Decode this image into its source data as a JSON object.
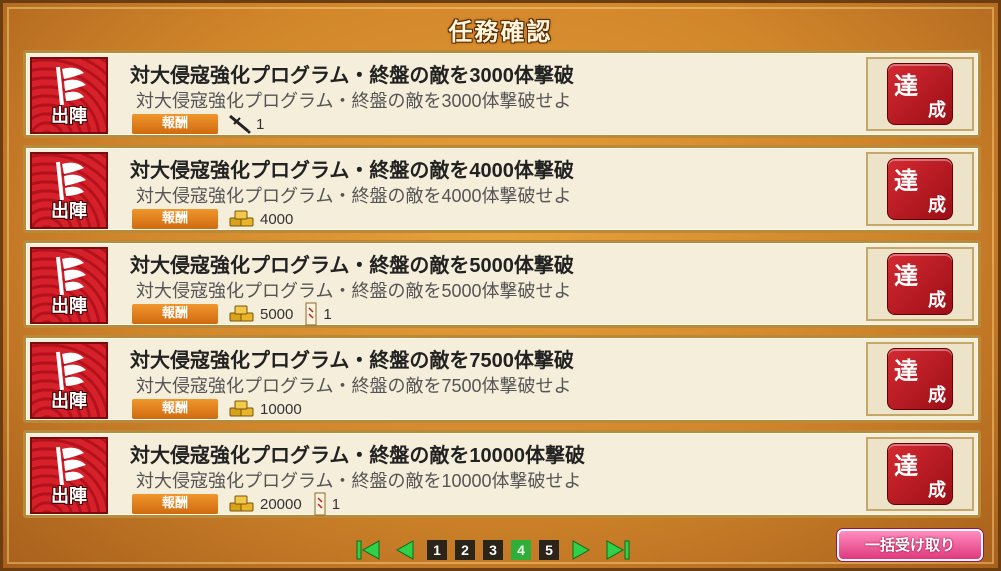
{
  "header": {
    "title": "任務確認"
  },
  "missions": [
    {
      "badge": "出陣",
      "title": "対大侵寇強化プログラム・終盤の敵を3000体撃破",
      "desc": "対大侵寇強化プログラム・終盤の敵を3000体撃破せよ",
      "reward_label": "報酬",
      "rewards": [
        {
          "icon": "sword-icon",
          "amount": "1"
        }
      ],
      "status": [
        "達",
        "成"
      ]
    },
    {
      "badge": "出陣",
      "title": "対大侵寇強化プログラム・終盤の敵を4000体撃破",
      "desc": "対大侵寇強化プログラム・終盤の敵を4000体撃破せよ",
      "reward_label": "報酬",
      "rewards": [
        {
          "icon": "gold-coin-icon",
          "amount": "4000"
        }
      ],
      "status": [
        "達",
        "成"
      ]
    },
    {
      "badge": "出陣",
      "title": "対大侵寇強化プログラム・終盤の敵を5000体撃破",
      "desc": "対大侵寇強化プログラム・終盤の敵を5000体撃破せよ",
      "reward_label": "報酬",
      "rewards": [
        {
          "icon": "gold-coin-icon",
          "amount": "5000"
        },
        {
          "icon": "scroll-ticket-icon",
          "amount": "1"
        }
      ],
      "status": [
        "達",
        "成"
      ]
    },
    {
      "badge": "出陣",
      "title": "対大侵寇強化プログラム・終盤の敵を7500体撃破",
      "desc": "対大侵寇強化プログラム・終盤の敵を7500体撃破せよ",
      "reward_label": "報酬",
      "rewards": [
        {
          "icon": "gold-coin-icon",
          "amount": "10000"
        }
      ],
      "status": [
        "達",
        "成"
      ]
    },
    {
      "badge": "出陣",
      "title": "対大侵寇強化プログラム・終盤の敵を10000体撃破",
      "desc": "対大侵寇強化プログラム・終盤の敵を10000体撃破せよ",
      "reward_label": "報酬",
      "rewards": [
        {
          "icon": "gold-coin-icon",
          "amount": "20000"
        },
        {
          "icon": "scroll-ticket-icon",
          "amount": "1"
        }
      ],
      "status": [
        "達",
        "成"
      ]
    }
  ],
  "pager": {
    "pages": [
      "1",
      "2",
      "3",
      "4",
      "5"
    ],
    "current": "4"
  },
  "bulk_button": {
    "label": "一括受け取り"
  },
  "colors": {
    "accent_green": "#2fae3a",
    "badge_red": "#d6202a",
    "reward_orange": "#e07d1e",
    "bulk_pink": "#e0387c"
  }
}
